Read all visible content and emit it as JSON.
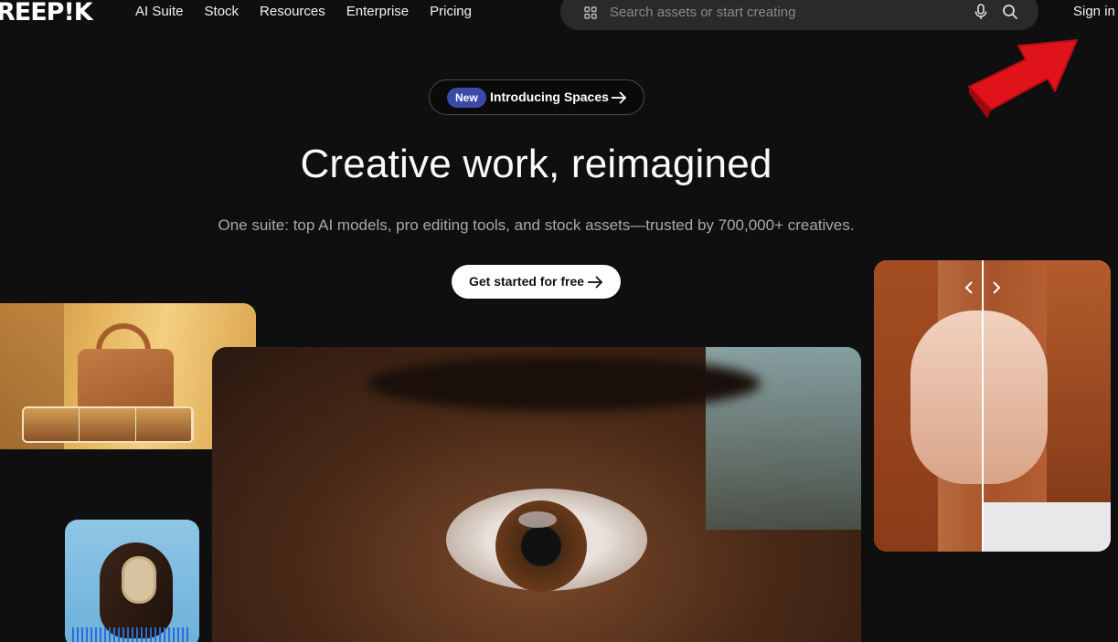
{
  "brand": {
    "logo_text": "REEP!K"
  },
  "nav": {
    "items": [
      "AI Suite",
      "Stock",
      "Resources",
      "Enterprise",
      "Pricing"
    ]
  },
  "search": {
    "placeholder": "Search assets or start creating"
  },
  "header": {
    "signin_label": "Sign in"
  },
  "announcement": {
    "badge": "New",
    "text": "Introducing Spaces"
  },
  "hero": {
    "title": "Creative work, reimagined",
    "subtitle": "One suite: top AI models, pro editing tools, and stock assets—trusted by 700,000+ creatives.",
    "cta_label": "Get started for free"
  },
  "colors": {
    "background": "#0f0f0f",
    "badge": "#3b4aa9",
    "annotation_arrow": "#e0131a"
  },
  "icons": {
    "search_grid": "grid-icon",
    "voice": "microphone-icon",
    "search": "search-icon",
    "arrow": "arrow-right-icon"
  }
}
